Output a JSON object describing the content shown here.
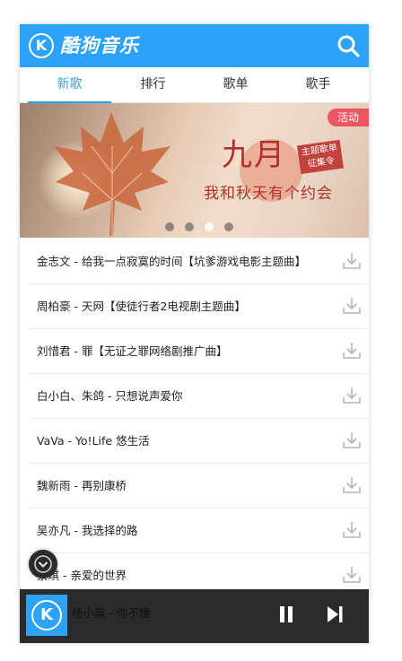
{
  "header": {
    "logo_letter": "K",
    "brand": "酷狗音乐",
    "brand_color": "#2ca2f9"
  },
  "tabs": [
    {
      "label": "新歌",
      "active": true
    },
    {
      "label": "排行",
      "active": false
    },
    {
      "label": "歌单",
      "active": false
    },
    {
      "label": "歌手",
      "active": false
    }
  ],
  "banner": {
    "tag": "活动",
    "title": "九月",
    "badge": "主题歌单征集令",
    "subtitle": "我和秋天有个约会",
    "slide_count": 4,
    "active_slide": 3
  },
  "songs": [
    {
      "title": "金志文 - 给我一点寂寞的时间【坑爹游戏电影主题曲】"
    },
    {
      "title": "周柏豪 - 天网【使徒行者2电视剧主题曲】"
    },
    {
      "title": "刘惜君 - 罪【无证之罪网络剧推广曲】"
    },
    {
      "title": "白小白、朱鸽 - 只想说声爱你"
    },
    {
      "title": "VaVa - Yo!Life 悠生活"
    },
    {
      "title": "魏新雨 - 再别康桥"
    },
    {
      "title": "吴亦凡 - 我选择的路"
    },
    {
      "title": "蔡琪 - 亲爱的世界"
    },
    {
      "title": "杨小晨 - 你不懂"
    }
  ],
  "player": {
    "cover_letter": "K",
    "now_playing": "杨小晨 - 你不懂"
  },
  "icons": {
    "search": "search-icon",
    "download": "download-icon",
    "pause": "pause-icon",
    "next": "next-track-icon",
    "collapse": "chevron-down-icon"
  }
}
